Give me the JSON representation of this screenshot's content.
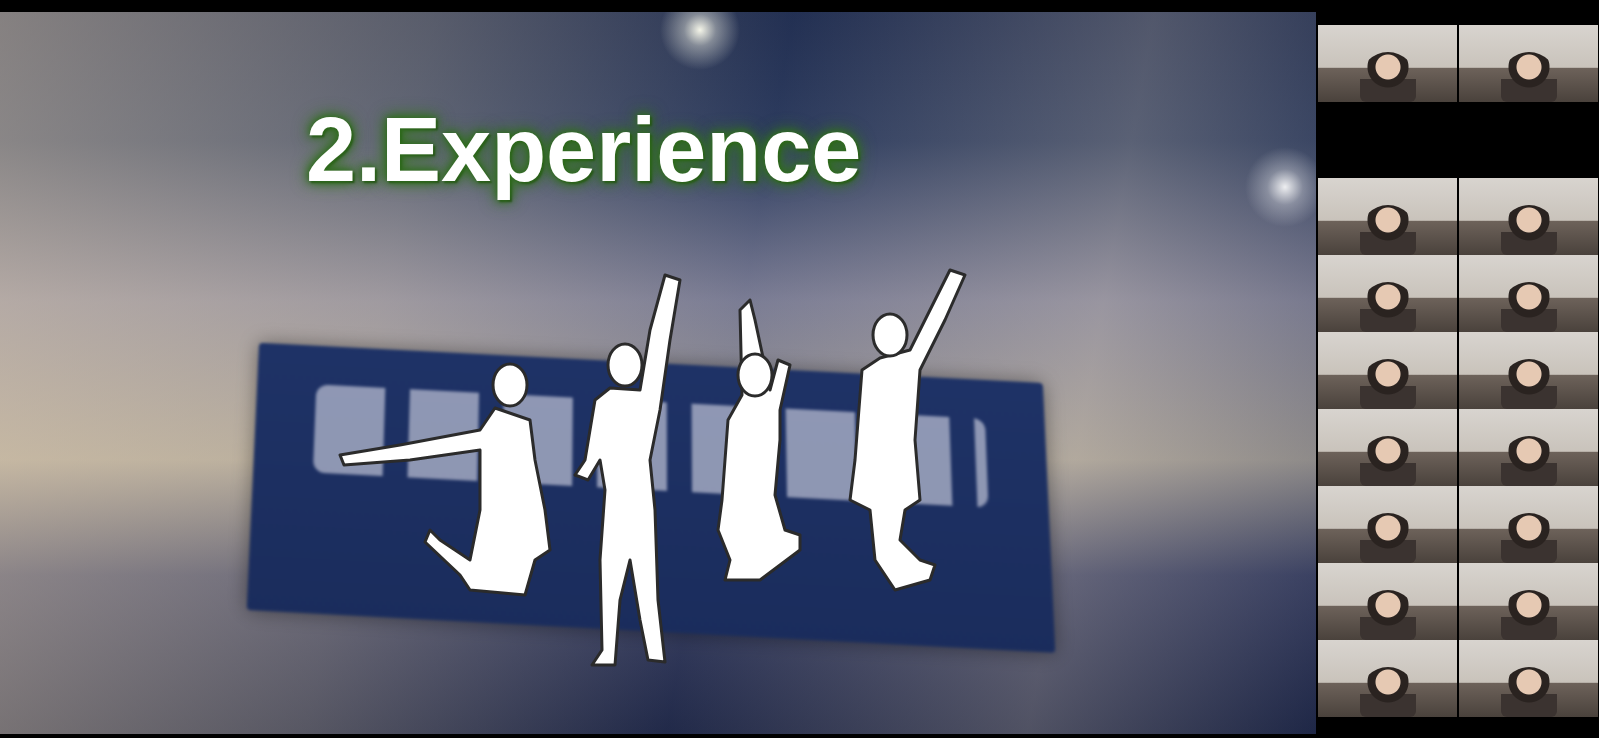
{
  "slide": {
    "title": "2.Experience"
  },
  "gallery": {
    "top": [
      {
        "camera": true
      },
      {
        "camera": true
      }
    ],
    "grid": [
      {
        "camera": true
      },
      {
        "camera": true
      },
      {
        "camera": true
      },
      {
        "camera": true
      },
      {
        "camera": true
      },
      {
        "camera": true
      },
      {
        "camera": true
      },
      {
        "camera": true
      },
      {
        "camera": true
      },
      {
        "camera": true
      },
      {
        "camera": true
      },
      {
        "camera": true
      },
      {
        "camera": true
      },
      {
        "camera": true
      }
    ]
  }
}
